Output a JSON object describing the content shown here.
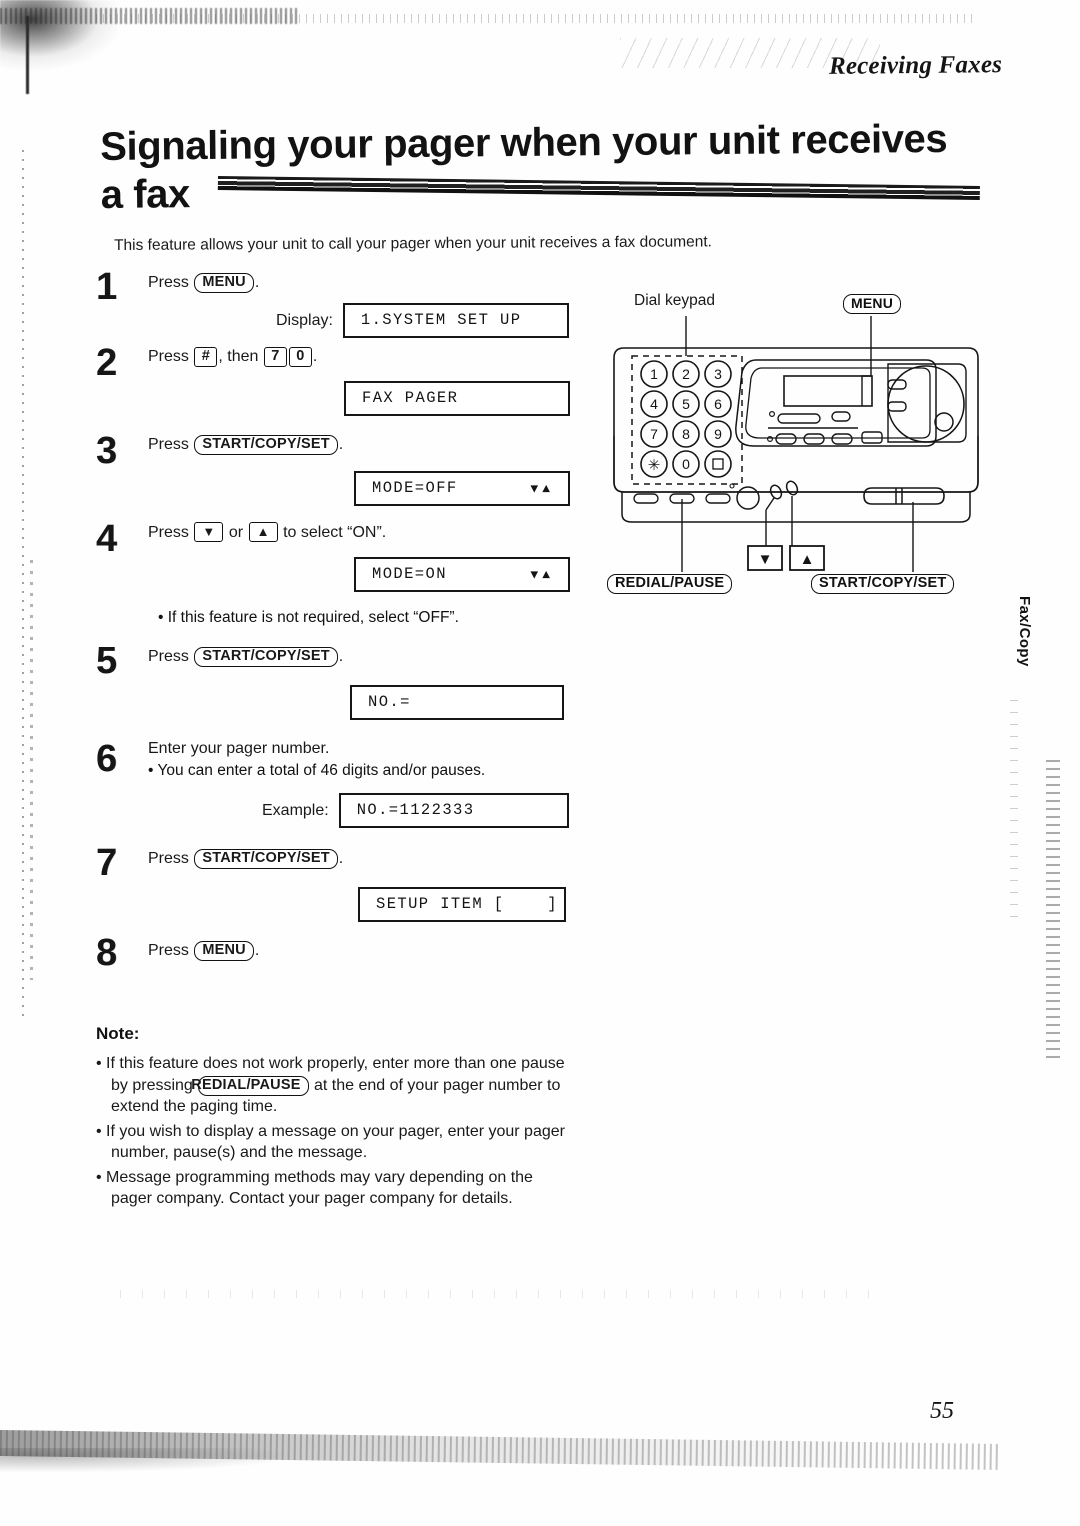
{
  "header": {
    "running_head": "Receiving Faxes",
    "title": "Signaling your pager when your unit receives a fax",
    "title_line1": "Signaling your pager when your unit receives",
    "title_line2": "a fax"
  },
  "intro": "This feature allows your unit to call your pager when your unit receives a fax document.",
  "steps": [
    {
      "number": "1",
      "text_before": "Press",
      "key": "MENU",
      "text_after": ".",
      "display_label": "Display:",
      "display_value": "1.SYSTEM SET UP",
      "display_arrows": ""
    },
    {
      "number": "2",
      "text_before": "Press",
      "key": "#",
      "text_mid": ", then",
      "key2": "7",
      "key3": "0",
      "text_after": ".",
      "display_label": "",
      "display_value": "FAX PAGER",
      "display_arrows": ""
    },
    {
      "number": "3",
      "text_before": "Press",
      "key": "START/COPY/SET",
      "text_after": ".",
      "display_label": "",
      "display_value": "MODE=OFF",
      "display_arrows": "▼▲"
    },
    {
      "number": "4",
      "text_before": "Press",
      "key": "▼",
      "text_mid": "or",
      "key2": "▲",
      "text_after": "to select “ON”.",
      "display_label": "",
      "display_value": "MODE=ON",
      "display_arrows": "▼▲",
      "sub_bullet": "If this feature is not required, select “OFF”."
    },
    {
      "number": "5",
      "text_before": "Press",
      "key": "START/COPY/SET",
      "text_after": ".",
      "display_label": "",
      "display_value": "NO.=",
      "display_arrows": ""
    },
    {
      "number": "6",
      "text_before": "Enter your pager number.",
      "sub_bullet": "You can enter a total of 46 digits and/or pauses.",
      "display_label": "Example:",
      "display_value": "NO.=1122333",
      "display_arrows": ""
    },
    {
      "number": "7",
      "text_before": "Press",
      "key": "START/COPY/SET",
      "text_after": ".",
      "display_label": "",
      "display_value": "SETUP ITEM [    ]",
      "display_arrows": ""
    },
    {
      "number": "8",
      "text_before": "Press",
      "key": "MENU",
      "text_after": ".",
      "display_label": "",
      "display_value": "",
      "display_arrows": ""
    }
  ],
  "note": {
    "title": "Note:",
    "items": [
      {
        "part1": "If this feature does not work properly, enter more than one pause by pressing",
        "key": "REDIAL/PAUSE",
        "part2": "at the end of your pager number to extend the paging time."
      },
      {
        "part1": "If you wish to display a message on your pager, enter your pager number, pause(s) and the message.",
        "key": "",
        "part2": ""
      },
      {
        "part1": "Message programming methods may vary depending on the pager company. Contact your pager company for details.",
        "key": "",
        "part2": ""
      }
    ]
  },
  "diagram": {
    "callout_dial_keypad": "Dial keypad",
    "callout_menu": "MENU",
    "callout_redial_pause": "REDIAL/PAUSE",
    "callout_start_copy_set": "START/COPY/SET",
    "keypad_keys": [
      "1",
      "2",
      "3",
      "4",
      "5",
      "6",
      "7",
      "8",
      "9",
      "✳",
      "0",
      "#"
    ]
  },
  "side_tab": "Fax/Copy",
  "page_number": "55",
  "colors": {
    "ink": "#141414",
    "paper": "#fefefe"
  }
}
